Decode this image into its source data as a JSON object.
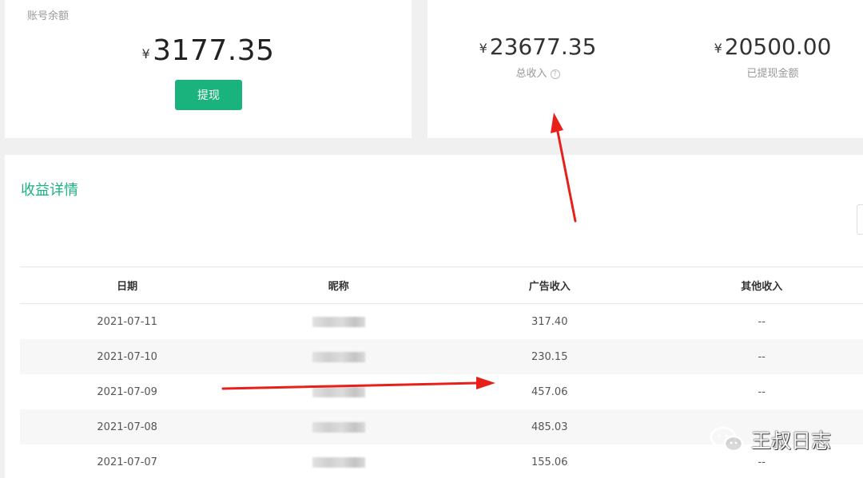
{
  "balance": {
    "label": "账号余额",
    "currency": "¥",
    "amount": "3177.35",
    "withdraw_button": "提现"
  },
  "income": {
    "total": {
      "currency": "¥",
      "value": "23677.35",
      "label": "总收入",
      "help_icon": "question-circle-icon"
    },
    "withdrawn": {
      "currency": "¥",
      "value": "20500.00",
      "label": "已提现金额"
    }
  },
  "details": {
    "title": "收益详情",
    "columns": [
      "日期",
      "昵称",
      "广告收入",
      "其他收入"
    ],
    "rows": [
      {
        "date": "2021-07-11",
        "ad_income": "317.40",
        "other_income": "--"
      },
      {
        "date": "2021-07-10",
        "ad_income": "230.15",
        "other_income": "--"
      },
      {
        "date": "2021-07-09",
        "ad_income": "457.06",
        "other_income": "--"
      },
      {
        "date": "2021-07-08",
        "ad_income": "485.03",
        "other_income": ""
      },
      {
        "date": "2021-07-07",
        "ad_income": "155.06",
        "other_income": "--"
      }
    ]
  },
  "watermark": {
    "text": "王叔日志",
    "icon": "wechat-icon"
  },
  "colors": {
    "accent": "#1ab37e",
    "arrow": "#e8201a",
    "background": "#f0f0f0"
  }
}
